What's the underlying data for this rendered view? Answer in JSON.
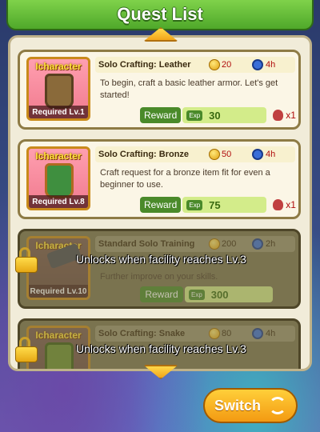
{
  "header": {
    "title": "Quest List"
  },
  "quests": [
    {
      "portrait_label": "Icharacter",
      "required": "Required Lv.1",
      "title": "Solo Crafting: Leather",
      "cost": "20",
      "time": "4h",
      "description": "To begin, craft a basic leather armor. Let's get started!",
      "reward_label": "Reward",
      "exp_tag": "Exp",
      "exp": "30",
      "item_qty": "x1"
    },
    {
      "portrait_label": "Icharacter",
      "required": "Required Lv.8",
      "title": "Solo Crafting: Bronze",
      "cost": "50",
      "time": "4h",
      "description": "Craft request for a bronze item fit for even a beginner to use.",
      "reward_label": "Reward",
      "exp_tag": "Exp",
      "exp": "75",
      "item_qty": "x1"
    },
    {
      "portrait_label": "Icharacter",
      "required": "Required Lv.10",
      "title": "Standard Solo Training",
      "cost": "200",
      "time": "2h",
      "description": "Further improve on your skills.",
      "reward_label": "Reward",
      "exp_tag": "Exp",
      "exp": "300",
      "locked_text": "Unlocks when facility reaches Lv.3"
    },
    {
      "portrait_label": "Icharacter",
      "title": "Solo Crafting: Snake",
      "cost": "80",
      "time": "4h",
      "locked_text": "Unlocks when facility reaches Lv.3"
    }
  ],
  "switch_button": {
    "label": "Switch"
  }
}
